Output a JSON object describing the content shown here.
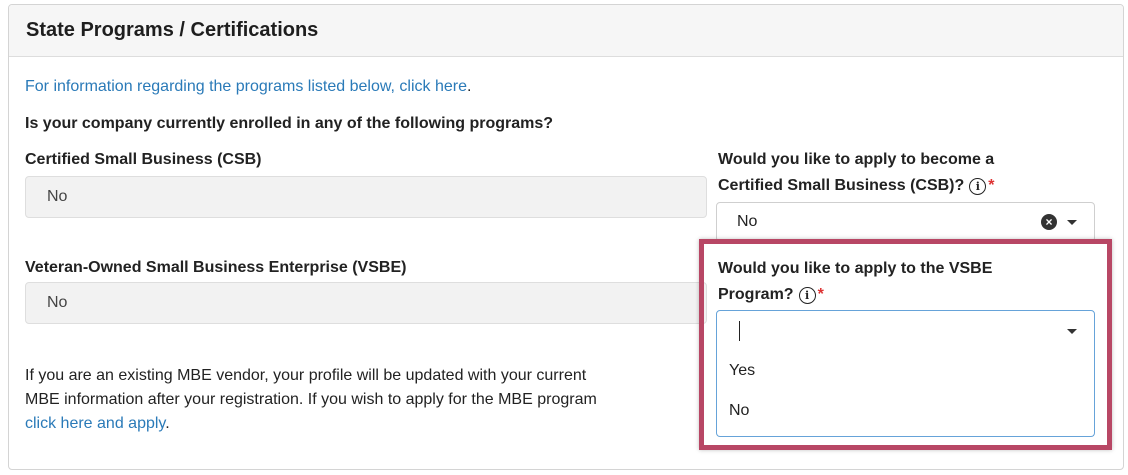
{
  "panel": {
    "title": "State Programs / Certifications"
  },
  "info": {
    "link_text": "For information regarding the programs listed below, click here",
    "period": ".",
    "question": "Is your company currently enrolled in any of the following programs?"
  },
  "csb": {
    "label": "Certified Small Business (CSB)",
    "value": "No",
    "apply_label_line1": "Would you like to apply to become a",
    "apply_label_line2": "Certified Small Business (CSB)?",
    "required_mark": "*",
    "apply_value": "No"
  },
  "vsbe": {
    "label": "Veteran-Owned Small Business Enterprise (VSBE)",
    "value": "No",
    "apply_label_line1": "Would you like to apply to the VSBE",
    "apply_label_line2": "Program?",
    "required_mark": "*",
    "apply_value": "",
    "options": [
      "Yes",
      "No"
    ]
  },
  "mbe": {
    "line1": "If you are an existing MBE vendor, your profile will be updated with your current",
    "line2": "MBE information after your registration. If you wish to apply for the MBE program",
    "link_text": "click here and apply",
    "period": "."
  },
  "colors": {
    "link": "#2a7ab8",
    "highlight": "#b84765",
    "required": "#dd3333",
    "focus_border": "#66a3d9"
  },
  "icons": {
    "info": "info-circle-icon",
    "clear": "clear-circle-icon",
    "caret": "caret-down-icon"
  }
}
